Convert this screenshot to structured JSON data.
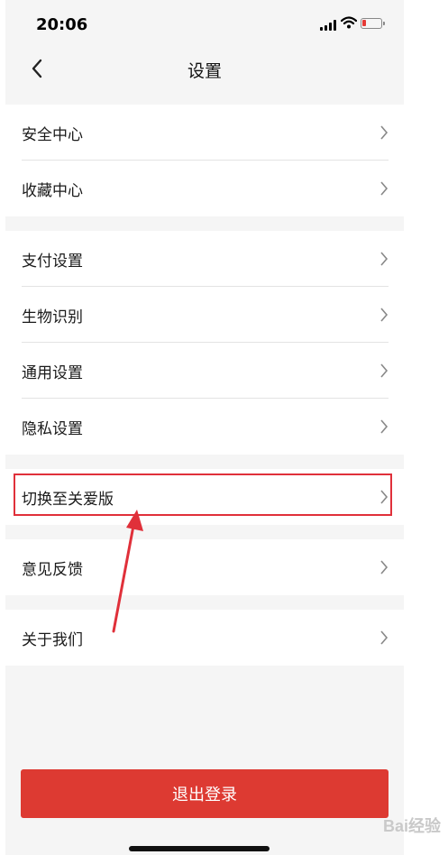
{
  "status_bar": {
    "time": "20:06"
  },
  "nav": {
    "title": "设置"
  },
  "groups": [
    {
      "items": [
        {
          "label": "安全中心"
        },
        {
          "label": "收藏中心"
        }
      ]
    },
    {
      "items": [
        {
          "label": "支付设置"
        },
        {
          "label": "生物识别"
        },
        {
          "label": "通用设置"
        },
        {
          "label": "隐私设置"
        }
      ]
    },
    {
      "items": [
        {
          "label": "切换至关爱版"
        }
      ]
    },
    {
      "items": [
        {
          "label": "意见反馈"
        }
      ]
    },
    {
      "items": [
        {
          "label": "关于我们"
        }
      ]
    }
  ],
  "logout": {
    "label": "退出登录"
  },
  "watermark": {
    "text": "Bai经验"
  },
  "colors": {
    "accent": "#dd3a32",
    "highlight_border": "#e0303a",
    "background": "#f5f5f5"
  },
  "icons": [
    "back-icon",
    "chevron-right-icon",
    "signal-icon",
    "wifi-icon",
    "battery-icon"
  ]
}
